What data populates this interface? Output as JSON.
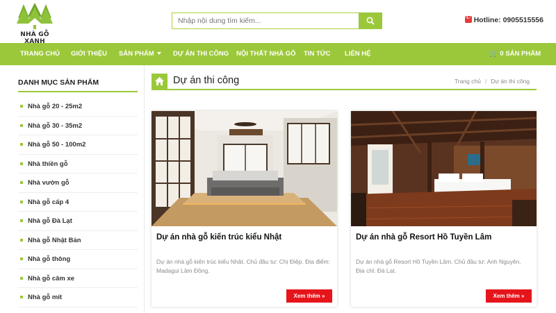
{
  "brand": {
    "name": "NHÀ GỖ XANH",
    "accent": "#9bc83a",
    "button_red": "#e6141b"
  },
  "search": {
    "placeholder": "Nhập nội dung tìm kiếm...",
    "icon": "search-icon"
  },
  "hotline": {
    "label": "Hotline: 0905515556",
    "icon": "phone-icon"
  },
  "nav": {
    "items": [
      {
        "label": "TRANG CHỦ"
      },
      {
        "label": "GIỚI THIỆU"
      },
      {
        "label": "SẢN PHẨM"
      },
      {
        "label": "DỰ ÁN THI CÔNG"
      },
      {
        "label": "NỘI THẤT NHÀ GỖ"
      },
      {
        "label": "TIN TỨC"
      },
      {
        "label": "LIÊN HỆ"
      }
    ],
    "cart": "0 SẢN PHẨM"
  },
  "sidebar": {
    "title": "DANH MỤC SẢN PHẨM",
    "items": [
      "Nhà gỗ 20 - 25m2",
      "Nhà gỗ 30 - 35m2",
      "Nhà gỗ 50 - 100m2",
      "Nhà thiền gỗ",
      "Nhà vườn gỗ",
      "Nhà gỗ cấp 4",
      "Nhà gỗ Đà Lạt",
      "Nhà gỗ Nhật Bản",
      "Nhà gỗ thông",
      "Nhà gỗ căm xe",
      "Nhà gỗ mít"
    ]
  },
  "page": {
    "title": "Dự án thi công",
    "breadcrumb": {
      "home": "Trang chủ",
      "current": "Dự án thi công"
    }
  },
  "projects": [
    {
      "title": "Dự án nhà gỗ kiến trúc kiểu Nhật",
      "desc": "Dự án nhà gỗ kiến trúc kiểu Nhật. Chủ đầu tư: Chị Điệp. Địa điểm: Madagui Lâm Đồng.",
      "more": "Xem thêm »"
    },
    {
      "title": "Dự án nhà gỗ Resort Hồ Tuyền Lâm",
      "desc": "Dự án nhà gỗ Resort Hồ Tuyền Lâm. Chủ đầu tư: Anh Nguyên. Địa chỉ: Đà Lạt.",
      "more": "Xem thêm »"
    }
  ]
}
